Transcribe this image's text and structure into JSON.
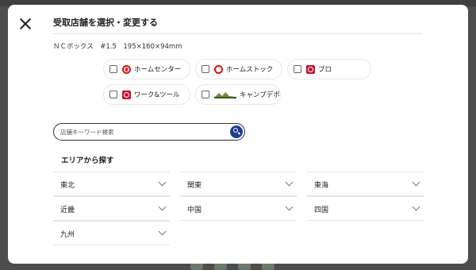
{
  "modal": {
    "title": "受取店舗を選択・変更する",
    "product": "ＮＣボックス　#1.5　195×160×94mm"
  },
  "store_filters": [
    {
      "label": "ホームセンター",
      "logo": "homecenter-logo",
      "checked": false
    },
    {
      "label": "ホームストック",
      "logo": "homestock-logo",
      "checked": false
    },
    {
      "label": "プロ",
      "logo": "pro-logo",
      "checked": false
    },
    {
      "label": "ワーク&ツール",
      "logo": "worktool-logo",
      "checked": false
    },
    {
      "label": "キャンプデポ",
      "logo": "campdepot-logo",
      "checked": false
    }
  ],
  "search": {
    "placeholder": "店舗キーワード検索",
    "value": ""
  },
  "areas": {
    "heading": "エリアから探す",
    "items": [
      "東北",
      "関東",
      "東海",
      "近畿",
      "中国",
      "四国",
      "九州"
    ]
  },
  "colors": {
    "accent": "#1f3d8f",
    "brand_red": "#d11111",
    "overlay": "#4d4d4d"
  }
}
